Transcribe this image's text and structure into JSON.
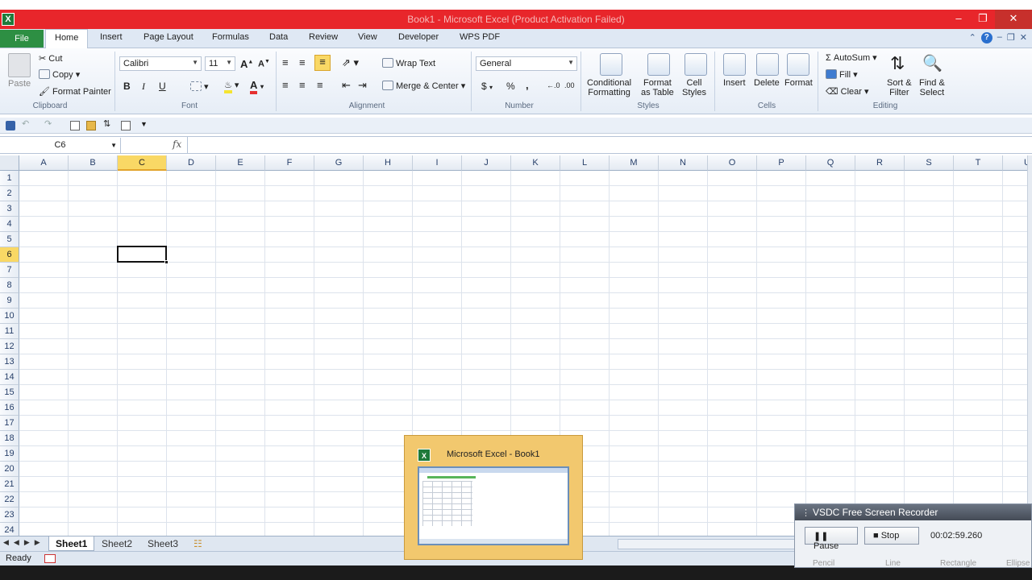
{
  "window": {
    "title": "Book1 - Microsoft Excel (Product Activation Failed)",
    "app_icon": "X",
    "controls": [
      "minimize",
      "restore",
      "close"
    ]
  },
  "tabs": {
    "file": "File",
    "items": [
      "Home",
      "Insert",
      "Page Layout",
      "Formulas",
      "Data",
      "Review",
      "View",
      "Developer",
      "WPS PDF"
    ],
    "active": "Home"
  },
  "ribbon": {
    "clipboard": {
      "label": "Clipboard",
      "paste": "Paste",
      "cut": "Cut",
      "copy": "Copy",
      "format_painter": "Format Painter"
    },
    "font": {
      "label": "Font",
      "name": "Calibri",
      "size": "11",
      "bold": "B",
      "italic": "I",
      "underline": "U"
    },
    "alignment": {
      "label": "Alignment",
      "wrap_text": "Wrap Text",
      "merge_center": "Merge & Center"
    },
    "number": {
      "label": "Number",
      "format": "General",
      "currency": "$",
      "percent": "%",
      "comma": ","
    },
    "styles": {
      "label": "Styles",
      "conditional": "Conditional\nFormatting",
      "format_table": "Format\nas Table",
      "cell_styles": "Cell\nStyles"
    },
    "cells": {
      "label": "Cells",
      "insert": "Insert",
      "delete": "Delete",
      "format": "Format"
    },
    "editing": {
      "label": "Editing",
      "autosum": "AutoSum",
      "fill": "Fill",
      "clear": "Clear",
      "sort_filter": "Sort &\nFilter",
      "find_select": "Find &\nSelect"
    }
  },
  "formula_bar": {
    "name_box": "C6",
    "fx": "fx",
    "content": ""
  },
  "grid": {
    "columns": [
      "A",
      "B",
      "C",
      "D",
      "E",
      "F",
      "G",
      "H",
      "I",
      "J",
      "K",
      "L",
      "M",
      "N",
      "O",
      "P",
      "Q",
      "R",
      "S",
      "T",
      "U"
    ],
    "rows": [
      "1",
      "2",
      "3",
      "4",
      "5",
      "6",
      "7",
      "8",
      "9",
      "10",
      "11",
      "12",
      "13",
      "14",
      "15",
      "16",
      "17",
      "18",
      "19",
      "20",
      "21",
      "22",
      "23",
      "24"
    ],
    "selected_column": "C",
    "selected_row": "6"
  },
  "sheets": {
    "items": [
      "Sheet1",
      "Sheet2",
      "Sheet3"
    ],
    "active": "Sheet1"
  },
  "status": {
    "text": "Ready"
  },
  "taskbar_preview": {
    "title": "Microsoft Excel - Book1"
  },
  "recorder": {
    "title": "VSDC Free Screen Recorder",
    "pause": "Pause",
    "stop": "Stop",
    "elapsed": "00:02:59.260",
    "sub_items": [
      "Pencil",
      "Line",
      "Rectangle",
      "Ellipse"
    ]
  }
}
